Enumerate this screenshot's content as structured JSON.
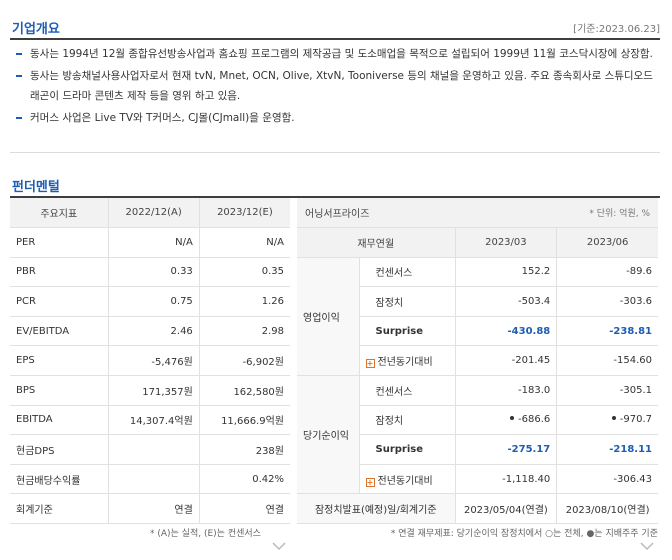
{
  "overview": {
    "title": "기업개요",
    "date_note": "[기준:2023.06.23]",
    "items": [
      "동사는 1994년 12월 종합유선방송사업과 홈쇼핑 프로그램의 제작공급 및 도소매업을 목적으로 설립되어 1999년 11월 코스닥시장에 상장함.",
      "동사는 방송채널사용사업자로서 현재 tvN, Mnet, OCN, Olive, XtvN, Tooniverse 등의 채널을 운영하고 있음. 주요 종속회사로 스튜디오드래곤이 드라마 콘텐츠 제작 등을 영위 하고 있음.",
      "커머스 사업은 Live TV와 T커머스, CJ몰(CJmall)을 운영함."
    ]
  },
  "fundamental": {
    "title": "펀더멘털",
    "left": {
      "headers": [
        "주요지표",
        "2022/12(A)",
        "2023/12(E)"
      ],
      "rows": [
        {
          "label": "PER",
          "a": "N/A",
          "e": "N/A"
        },
        {
          "label": "PBR",
          "a": "0.33",
          "e": "0.35"
        },
        {
          "label": "PCR",
          "a": "0.75",
          "e": "1.26"
        },
        {
          "label": "EV/EBITDA",
          "a": "2.46",
          "e": "2.98"
        },
        {
          "label": "EPS",
          "a": "-5,476원",
          "e": "-6,902원"
        },
        {
          "label": "BPS",
          "a": "171,357원",
          "e": "162,580원"
        },
        {
          "label": "EBITDA",
          "a": "14,307.4억원",
          "e": "11,666.9억원"
        },
        {
          "label": "현금DPS",
          "a": "",
          "e": "238원"
        },
        {
          "label": "현금배당수익률",
          "a": "",
          "e": "0.42%"
        },
        {
          "label": "회계기준",
          "a": "연결",
          "e": "연결"
        }
      ],
      "note": "* (A)는 실적, (E)는 컨센서스"
    },
    "right": {
      "title": "어닝서프라이즈",
      "unit": "* 단위: 억원, %",
      "headers": [
        "재무연월",
        "2023/03",
        "2023/06"
      ],
      "groups": [
        {
          "label": "영업이익",
          "rows": [
            {
              "label": "컨센서스",
              "v1": "152.2",
              "v2": "-89.6"
            },
            {
              "label": "잠정치",
              "v1": "-503.4",
              "v2": "-303.6"
            },
            {
              "label": "Surprise",
              "v1": "-430.88",
              "v2": "-238.81"
            },
            {
              "label": "전년동기대비",
              "v1": "-201.45",
              "v2": "-154.60"
            }
          ]
        },
        {
          "label": "당기순이익",
          "rows": [
            {
              "label": "컨센서스",
              "v1": "-183.0",
              "v2": "-305.1"
            },
            {
              "label": "잠정치",
              "v1": "-686.6",
              "v2": "-970.7"
            },
            {
              "label": "Surprise",
              "v1": "-275.17",
              "v2": "-218.11"
            },
            {
              "label": "전년동기대비",
              "v1": "-1,118.40",
              "v2": "-306.43"
            }
          ]
        }
      ],
      "footer": {
        "label": "잠정치발표(예정)일/회계기준",
        "v1": "2023/05/04(연결)",
        "v2": "2023/08/10(연결)"
      },
      "note": "* 연결 재무제표: 당기순이익 잠정치에서 ○는 전체, ●는 지배주주 기준"
    }
  }
}
